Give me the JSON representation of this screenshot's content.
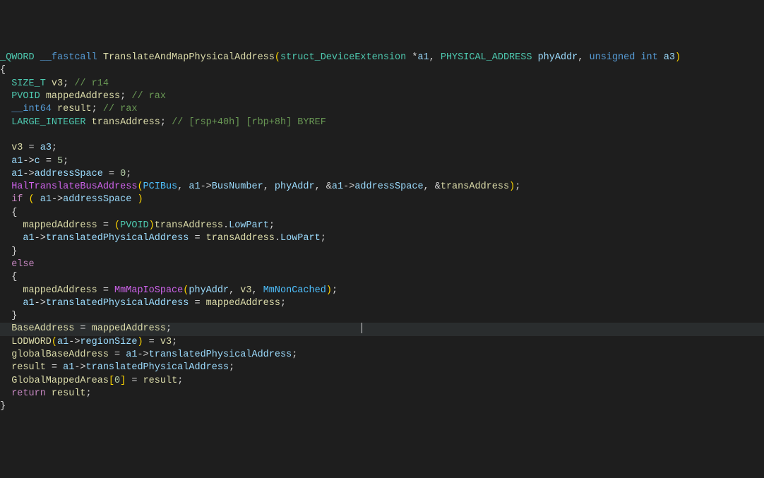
{
  "code": {
    "lines": [
      {
        "tokens": [
          {
            "t": "_QWORD",
            "c": "t-type"
          },
          {
            "t": " ",
            "c": ""
          },
          {
            "t": "__fastcall",
            "c": "t-kw2"
          },
          {
            "t": " ",
            "c": ""
          },
          {
            "t": "TranslateAndMapPhysicalAddress",
            "c": "t-func"
          },
          {
            "t": "(",
            "c": "t-paren"
          },
          {
            "t": "struct_DeviceExtension",
            "c": "t-type"
          },
          {
            "t": " *",
            "c": "t-op"
          },
          {
            "t": "a1",
            "c": "t-param"
          },
          {
            "t": ", ",
            "c": "t-punct"
          },
          {
            "t": "PHYSICAL_ADDRESS",
            "c": "t-type"
          },
          {
            "t": " ",
            "c": ""
          },
          {
            "t": "phyAddr",
            "c": "t-param"
          },
          {
            "t": ", ",
            "c": "t-punct"
          },
          {
            "t": "unsigned int",
            "c": "t-kw2"
          },
          {
            "t": " ",
            "c": ""
          },
          {
            "t": "a3",
            "c": "t-param"
          },
          {
            "t": ")",
            "c": "t-paren"
          }
        ]
      },
      {
        "tokens": [
          {
            "t": "{",
            "c": "t-punct"
          }
        ]
      },
      {
        "tokens": [
          {
            "t": "  ",
            "c": ""
          },
          {
            "t": "SIZE_T",
            "c": "t-type"
          },
          {
            "t": " ",
            "c": ""
          },
          {
            "t": "v3",
            "c": "t-var"
          },
          {
            "t": "; ",
            "c": "t-punct"
          },
          {
            "t": "// r14",
            "c": "t-comment"
          }
        ]
      },
      {
        "tokens": [
          {
            "t": "  ",
            "c": ""
          },
          {
            "t": "PVOID",
            "c": "t-type"
          },
          {
            "t": " ",
            "c": ""
          },
          {
            "t": "mappedAddress",
            "c": "t-var"
          },
          {
            "t": "; ",
            "c": "t-punct"
          },
          {
            "t": "// rax",
            "c": "t-comment"
          }
        ]
      },
      {
        "tokens": [
          {
            "t": "  ",
            "c": ""
          },
          {
            "t": "__int64",
            "c": "t-kw2"
          },
          {
            "t": " ",
            "c": ""
          },
          {
            "t": "result",
            "c": "t-var"
          },
          {
            "t": "; ",
            "c": "t-punct"
          },
          {
            "t": "// rax",
            "c": "t-comment"
          }
        ]
      },
      {
        "tokens": [
          {
            "t": "  ",
            "c": ""
          },
          {
            "t": "LARGE_INTEGER",
            "c": "t-type"
          },
          {
            "t": " ",
            "c": ""
          },
          {
            "t": "transAddress",
            "c": "t-var"
          },
          {
            "t": "; ",
            "c": "t-punct"
          },
          {
            "t": "// [rsp+40h] [rbp+8h] BYREF",
            "c": "t-comment"
          }
        ]
      },
      {
        "tokens": [
          {
            "t": "",
            "c": ""
          }
        ]
      },
      {
        "tokens": [
          {
            "t": "  ",
            "c": ""
          },
          {
            "t": "v3",
            "c": "t-var"
          },
          {
            "t": " = ",
            "c": "t-op"
          },
          {
            "t": "a3",
            "c": "t-param"
          },
          {
            "t": ";",
            "c": "t-punct"
          }
        ]
      },
      {
        "tokens": [
          {
            "t": "  ",
            "c": ""
          },
          {
            "t": "a1",
            "c": "t-param"
          },
          {
            "t": "->",
            "c": "t-op"
          },
          {
            "t": "c",
            "c": "t-member"
          },
          {
            "t": " = ",
            "c": "t-op"
          },
          {
            "t": "5",
            "c": "t-num"
          },
          {
            "t": ";",
            "c": "t-punct"
          }
        ]
      },
      {
        "tokens": [
          {
            "t": "  ",
            "c": ""
          },
          {
            "t": "a1",
            "c": "t-param"
          },
          {
            "t": "->",
            "c": "t-op"
          },
          {
            "t": "addressSpace",
            "c": "t-member"
          },
          {
            "t": " = ",
            "c": "t-op"
          },
          {
            "t": "0",
            "c": "t-num"
          },
          {
            "t": ";",
            "c": "t-punct"
          }
        ]
      },
      {
        "tokens": [
          {
            "t": "  ",
            "c": ""
          },
          {
            "t": "HalTranslateBusAddress",
            "c": "t-funccall"
          },
          {
            "t": "(",
            "c": "t-paren"
          },
          {
            "t": "PCIBus",
            "c": "t-const"
          },
          {
            "t": ", ",
            "c": "t-punct"
          },
          {
            "t": "a1",
            "c": "t-param"
          },
          {
            "t": "->",
            "c": "t-op"
          },
          {
            "t": "BusNumber",
            "c": "t-member"
          },
          {
            "t": ", ",
            "c": "t-punct"
          },
          {
            "t": "phyAddr",
            "c": "t-param"
          },
          {
            "t": ", &",
            "c": "t-op"
          },
          {
            "t": "a1",
            "c": "t-param"
          },
          {
            "t": "->",
            "c": "t-op"
          },
          {
            "t": "addressSpace",
            "c": "t-member"
          },
          {
            "t": ", &",
            "c": "t-op"
          },
          {
            "t": "transAddress",
            "c": "t-var"
          },
          {
            "t": ")",
            "c": "t-paren"
          },
          {
            "t": ";",
            "c": "t-punct"
          }
        ]
      },
      {
        "tokens": [
          {
            "t": "  ",
            "c": ""
          },
          {
            "t": "if",
            "c": "t-keyword"
          },
          {
            "t": " ",
            "c": ""
          },
          {
            "t": "(",
            "c": "t-paren"
          },
          {
            "t": " ",
            "c": ""
          },
          {
            "t": "a1",
            "c": "t-param"
          },
          {
            "t": "->",
            "c": "t-op"
          },
          {
            "t": "addressSpace",
            "c": "t-member"
          },
          {
            "t": " ",
            "c": ""
          },
          {
            "t": ")",
            "c": "t-paren"
          }
        ]
      },
      {
        "tokens": [
          {
            "t": "  {",
            "c": "t-punct"
          }
        ]
      },
      {
        "tokens": [
          {
            "t": "    ",
            "c": ""
          },
          {
            "t": "mappedAddress",
            "c": "t-var"
          },
          {
            "t": " = ",
            "c": "t-op"
          },
          {
            "t": "(",
            "c": "t-paren"
          },
          {
            "t": "PVOID",
            "c": "t-type"
          },
          {
            "t": ")",
            "c": "t-paren"
          },
          {
            "t": "transAddress",
            "c": "t-var"
          },
          {
            "t": ".",
            "c": "t-op"
          },
          {
            "t": "LowPart",
            "c": "t-member"
          },
          {
            "t": ";",
            "c": "t-punct"
          }
        ]
      },
      {
        "tokens": [
          {
            "t": "    ",
            "c": ""
          },
          {
            "t": "a1",
            "c": "t-param"
          },
          {
            "t": "->",
            "c": "t-op"
          },
          {
            "t": "translatedPhysicalAddress",
            "c": "t-member"
          },
          {
            "t": " = ",
            "c": "t-op"
          },
          {
            "t": "transAddress",
            "c": "t-var"
          },
          {
            "t": ".",
            "c": "t-op"
          },
          {
            "t": "LowPart",
            "c": "t-member"
          },
          {
            "t": ";",
            "c": "t-punct"
          }
        ]
      },
      {
        "tokens": [
          {
            "t": "  }",
            "c": "t-punct"
          }
        ]
      },
      {
        "tokens": [
          {
            "t": "  ",
            "c": ""
          },
          {
            "t": "else",
            "c": "t-keyword"
          }
        ]
      },
      {
        "tokens": [
          {
            "t": "  {",
            "c": "t-punct"
          }
        ]
      },
      {
        "tokens": [
          {
            "t": "    ",
            "c": ""
          },
          {
            "t": "mappedAddress",
            "c": "t-var"
          },
          {
            "t": " = ",
            "c": "t-op"
          },
          {
            "t": "MmMapIoSpace",
            "c": "t-funccall"
          },
          {
            "t": "(",
            "c": "t-paren"
          },
          {
            "t": "phyAddr",
            "c": "t-param"
          },
          {
            "t": ", ",
            "c": "t-punct"
          },
          {
            "t": "v3",
            "c": "t-var"
          },
          {
            "t": ", ",
            "c": "t-punct"
          },
          {
            "t": "MmNonCached",
            "c": "t-const"
          },
          {
            "t": ")",
            "c": "t-paren"
          },
          {
            "t": ";",
            "c": "t-punct"
          }
        ]
      },
      {
        "tokens": [
          {
            "t": "    ",
            "c": ""
          },
          {
            "t": "a1",
            "c": "t-param"
          },
          {
            "t": "->",
            "c": "t-op"
          },
          {
            "t": "translatedPhysicalAddress",
            "c": "t-member"
          },
          {
            "t": " = ",
            "c": "t-op"
          },
          {
            "t": "mappedAddress",
            "c": "t-var"
          },
          {
            "t": ";",
            "c": "t-punct"
          }
        ]
      },
      {
        "tokens": [
          {
            "t": "  }",
            "c": "t-punct"
          }
        ]
      },
      {
        "tokens": [
          {
            "t": "  ",
            "c": ""
          },
          {
            "t": "BaseAddress",
            "c": "t-var"
          },
          {
            "t": " = ",
            "c": "t-op"
          },
          {
            "t": "mappedAddress",
            "c": "t-var"
          },
          {
            "t": ";",
            "c": "t-punct"
          }
        ],
        "highlight": true,
        "cursor": true,
        "cursor_col": 63
      },
      {
        "tokens": [
          {
            "t": "  ",
            "c": ""
          },
          {
            "t": "LODWORD",
            "c": "t-func"
          },
          {
            "t": "(",
            "c": "t-paren"
          },
          {
            "t": "a1",
            "c": "t-param"
          },
          {
            "t": "->",
            "c": "t-op"
          },
          {
            "t": "regionSize",
            "c": "t-member"
          },
          {
            "t": ")",
            "c": "t-paren"
          },
          {
            "t": " = ",
            "c": "t-op"
          },
          {
            "t": "v3",
            "c": "t-var"
          },
          {
            "t": ";",
            "c": "t-punct"
          }
        ]
      },
      {
        "tokens": [
          {
            "t": "  ",
            "c": ""
          },
          {
            "t": "globalBaseAddress",
            "c": "t-var"
          },
          {
            "t": " = ",
            "c": "t-op"
          },
          {
            "t": "a1",
            "c": "t-param"
          },
          {
            "t": "->",
            "c": "t-op"
          },
          {
            "t": "translatedPhysicalAddress",
            "c": "t-member"
          },
          {
            "t": ";",
            "c": "t-punct"
          }
        ]
      },
      {
        "tokens": [
          {
            "t": "  ",
            "c": ""
          },
          {
            "t": "result",
            "c": "t-var"
          },
          {
            "t": " = ",
            "c": "t-op"
          },
          {
            "t": "a1",
            "c": "t-param"
          },
          {
            "t": "->",
            "c": "t-op"
          },
          {
            "t": "translatedPhysicalAddress",
            "c": "t-member"
          },
          {
            "t": ";",
            "c": "t-punct"
          }
        ]
      },
      {
        "tokens": [
          {
            "t": "  ",
            "c": ""
          },
          {
            "t": "GlobalMappedAreas",
            "c": "t-var"
          },
          {
            "t": "[",
            "c": "t-paren"
          },
          {
            "t": "0",
            "c": "t-num"
          },
          {
            "t": "]",
            "c": "t-paren"
          },
          {
            "t": " = ",
            "c": "t-op"
          },
          {
            "t": "result",
            "c": "t-var"
          },
          {
            "t": ";",
            "c": "t-punct"
          }
        ]
      },
      {
        "tokens": [
          {
            "t": "  ",
            "c": ""
          },
          {
            "t": "return",
            "c": "t-keyword"
          },
          {
            "t": " ",
            "c": ""
          },
          {
            "t": "result",
            "c": "t-var"
          },
          {
            "t": ";",
            "c": "t-punct"
          }
        ]
      },
      {
        "tokens": [
          {
            "t": "}",
            "c": "t-punct"
          }
        ]
      }
    ]
  }
}
